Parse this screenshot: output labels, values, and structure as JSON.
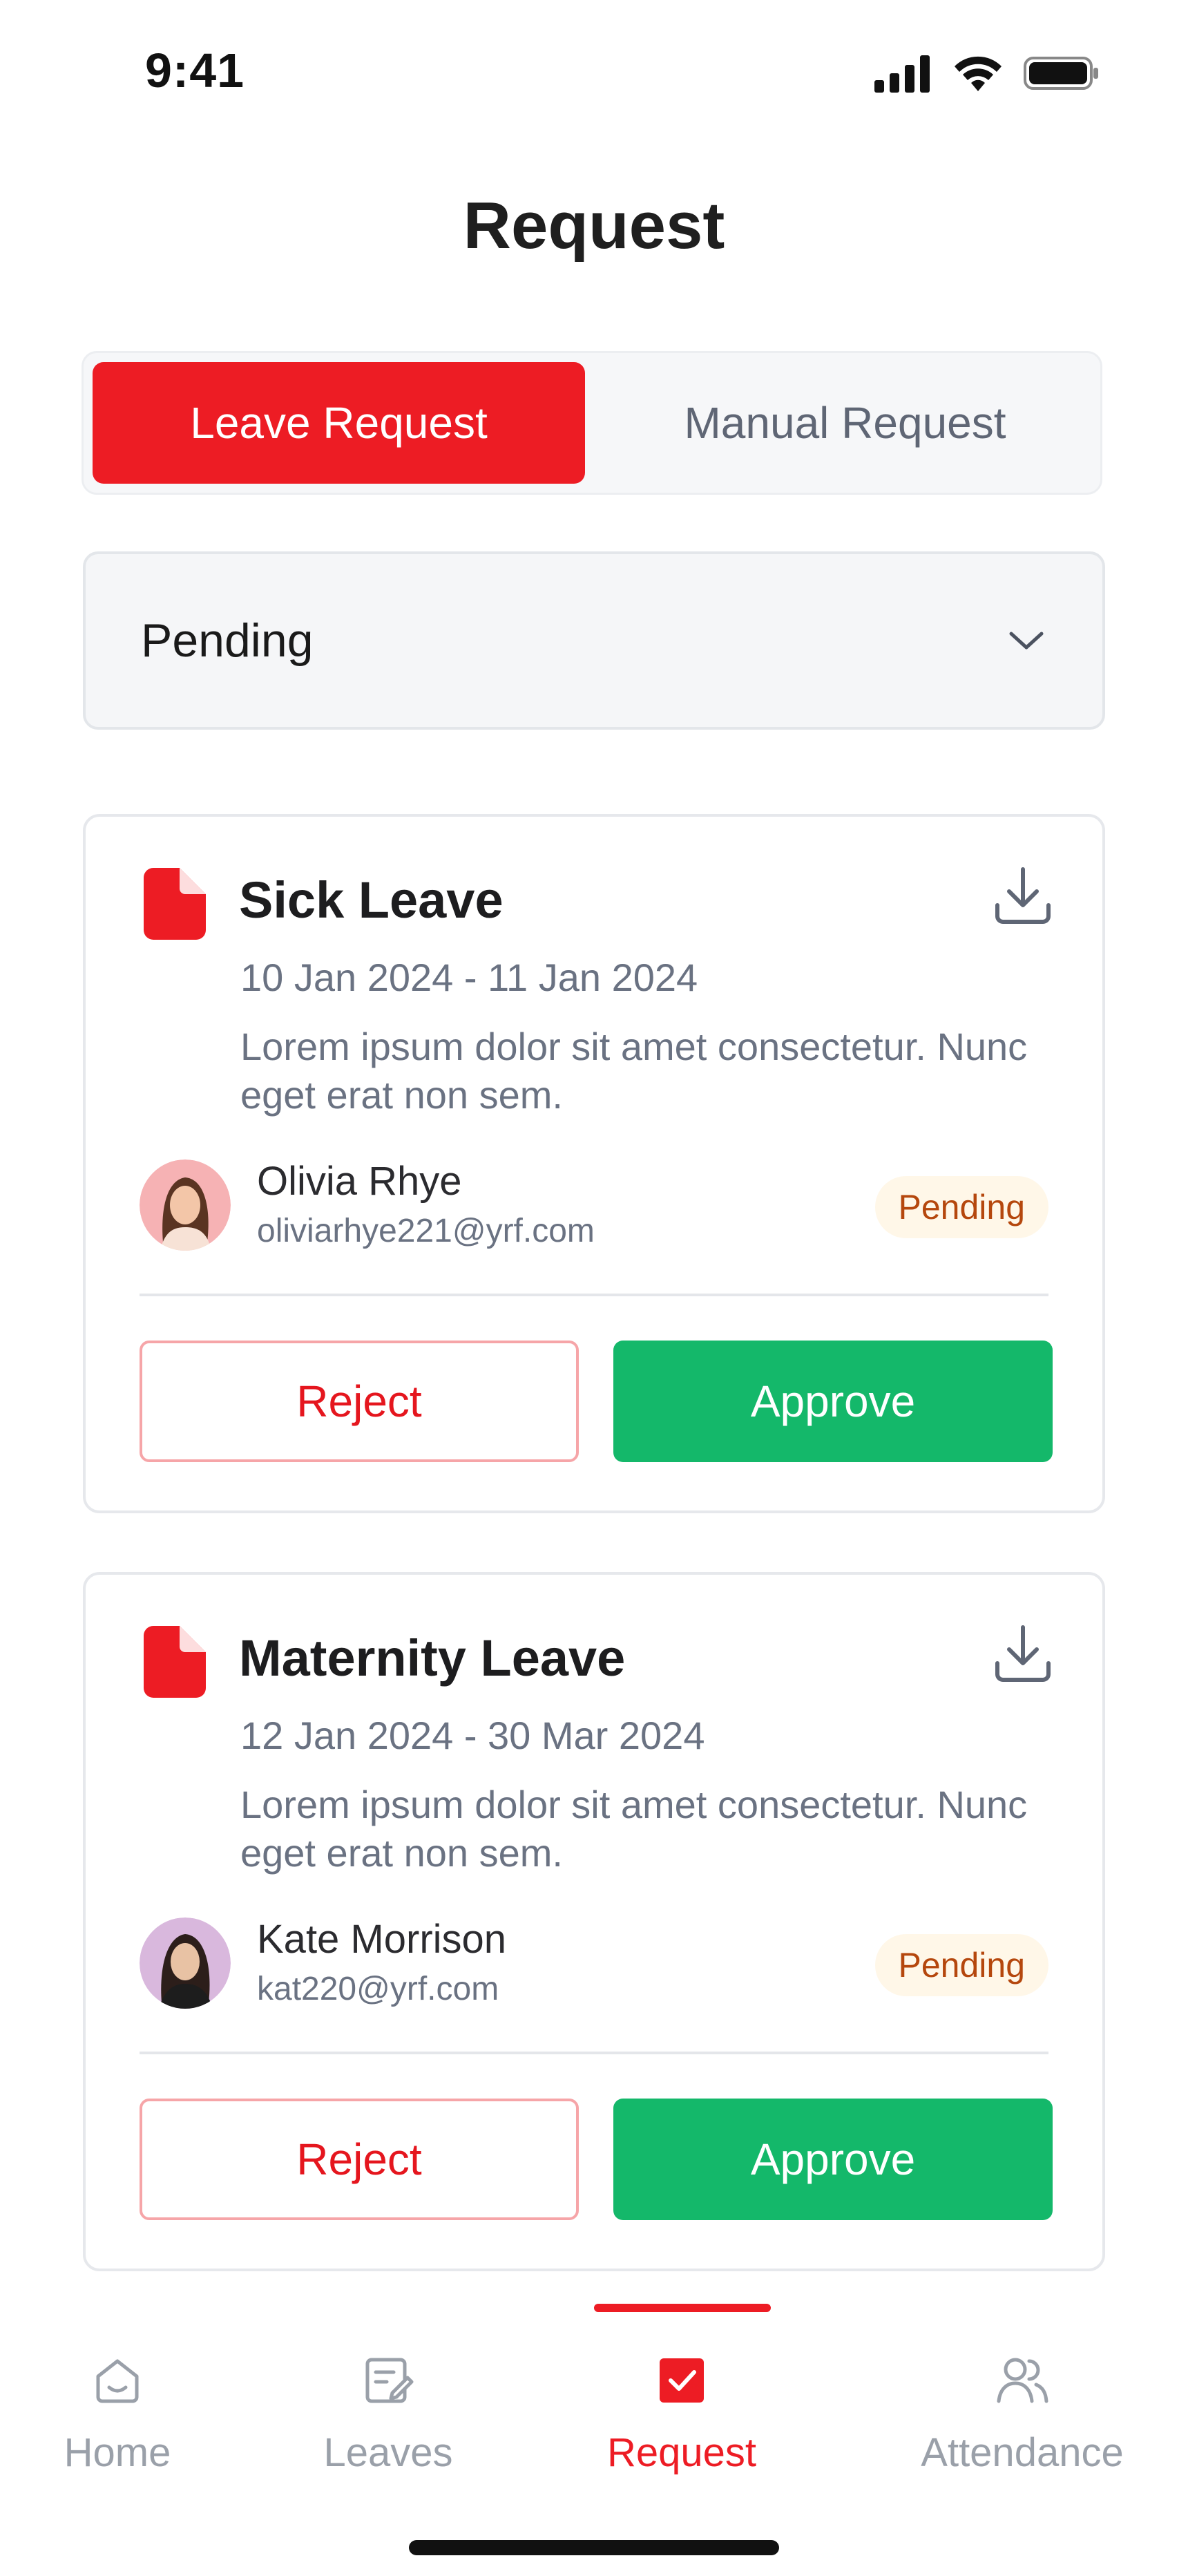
{
  "status_bar": {
    "time": "9:41",
    "icons": [
      "signal-icon",
      "wifi-icon",
      "battery-icon"
    ]
  },
  "page": {
    "title": "Request"
  },
  "tabs": [
    {
      "label": "Leave Request",
      "active": true
    },
    {
      "label": "Manual Request",
      "active": false
    }
  ],
  "filter": {
    "value": "Pending",
    "icon": "chevron-down-icon"
  },
  "requests": [
    {
      "type": "Sick Leave",
      "dates": "10 Jan 2024 - 11 Jan 2024",
      "description": "Lorem ipsum dolor sit amet consectetur. Nunc eget erat non sem.",
      "user": {
        "name": "Olivia Rhye",
        "email": "oliviarhye221@yrf.com"
      },
      "status": "Pending",
      "reject_label": "Reject",
      "approve_label": "Approve"
    },
    {
      "type": "Maternity Leave",
      "dates": "12 Jan 2024 - 30 Mar 2024",
      "description": "Lorem ipsum dolor sit amet consectetur. Nunc eget erat non sem.",
      "user": {
        "name": "Kate Morrison",
        "email": "kat220@yrf.com"
      },
      "status": "Pending",
      "reject_label": "Reject",
      "approve_label": "Approve"
    }
  ],
  "bottom_nav": [
    {
      "label": "Home",
      "icon": "home-icon",
      "active": false
    },
    {
      "label": "Leaves",
      "icon": "leaves-icon",
      "active": false
    },
    {
      "label": "Request",
      "icon": "request-check-icon",
      "active": true
    },
    {
      "label": "Attendance",
      "icon": "attendance-users-icon",
      "active": false
    }
  ],
  "colors": {
    "brand_red": "#ED1C24",
    "approve_green": "#14B86A",
    "badge_bg": "#FFF7E8",
    "badge_text": "#B5470D",
    "muted_text": "#6A7282"
  }
}
